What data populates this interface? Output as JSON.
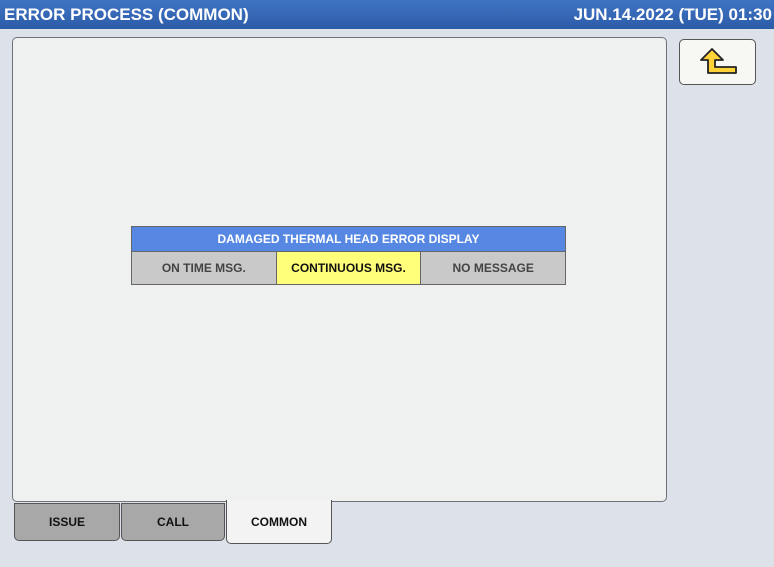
{
  "header": {
    "title": "ERROR PROCESS (COMMON)",
    "datetime": "JUN.14.2022 (TUE) 01:30"
  },
  "back_button": {
    "icon": "return-arrow-icon"
  },
  "setting": {
    "title": "DAMAGED THERMAL HEAD ERROR DISPLAY",
    "options": [
      "ON TIME MSG.",
      "CONTINUOUS MSG.",
      "NO MESSAGE"
    ],
    "selected": "CONTINUOUS MSG."
  },
  "tabs": [
    {
      "label": "ISSUE",
      "active": false
    },
    {
      "label": "CALL",
      "active": false
    },
    {
      "label": "COMMON",
      "active": true
    }
  ],
  "colors": {
    "header": "#2f62b0",
    "setting_title": "#5687e3",
    "selected_option": "#ffff7a",
    "inactive_tab": "#a8a8a8"
  }
}
